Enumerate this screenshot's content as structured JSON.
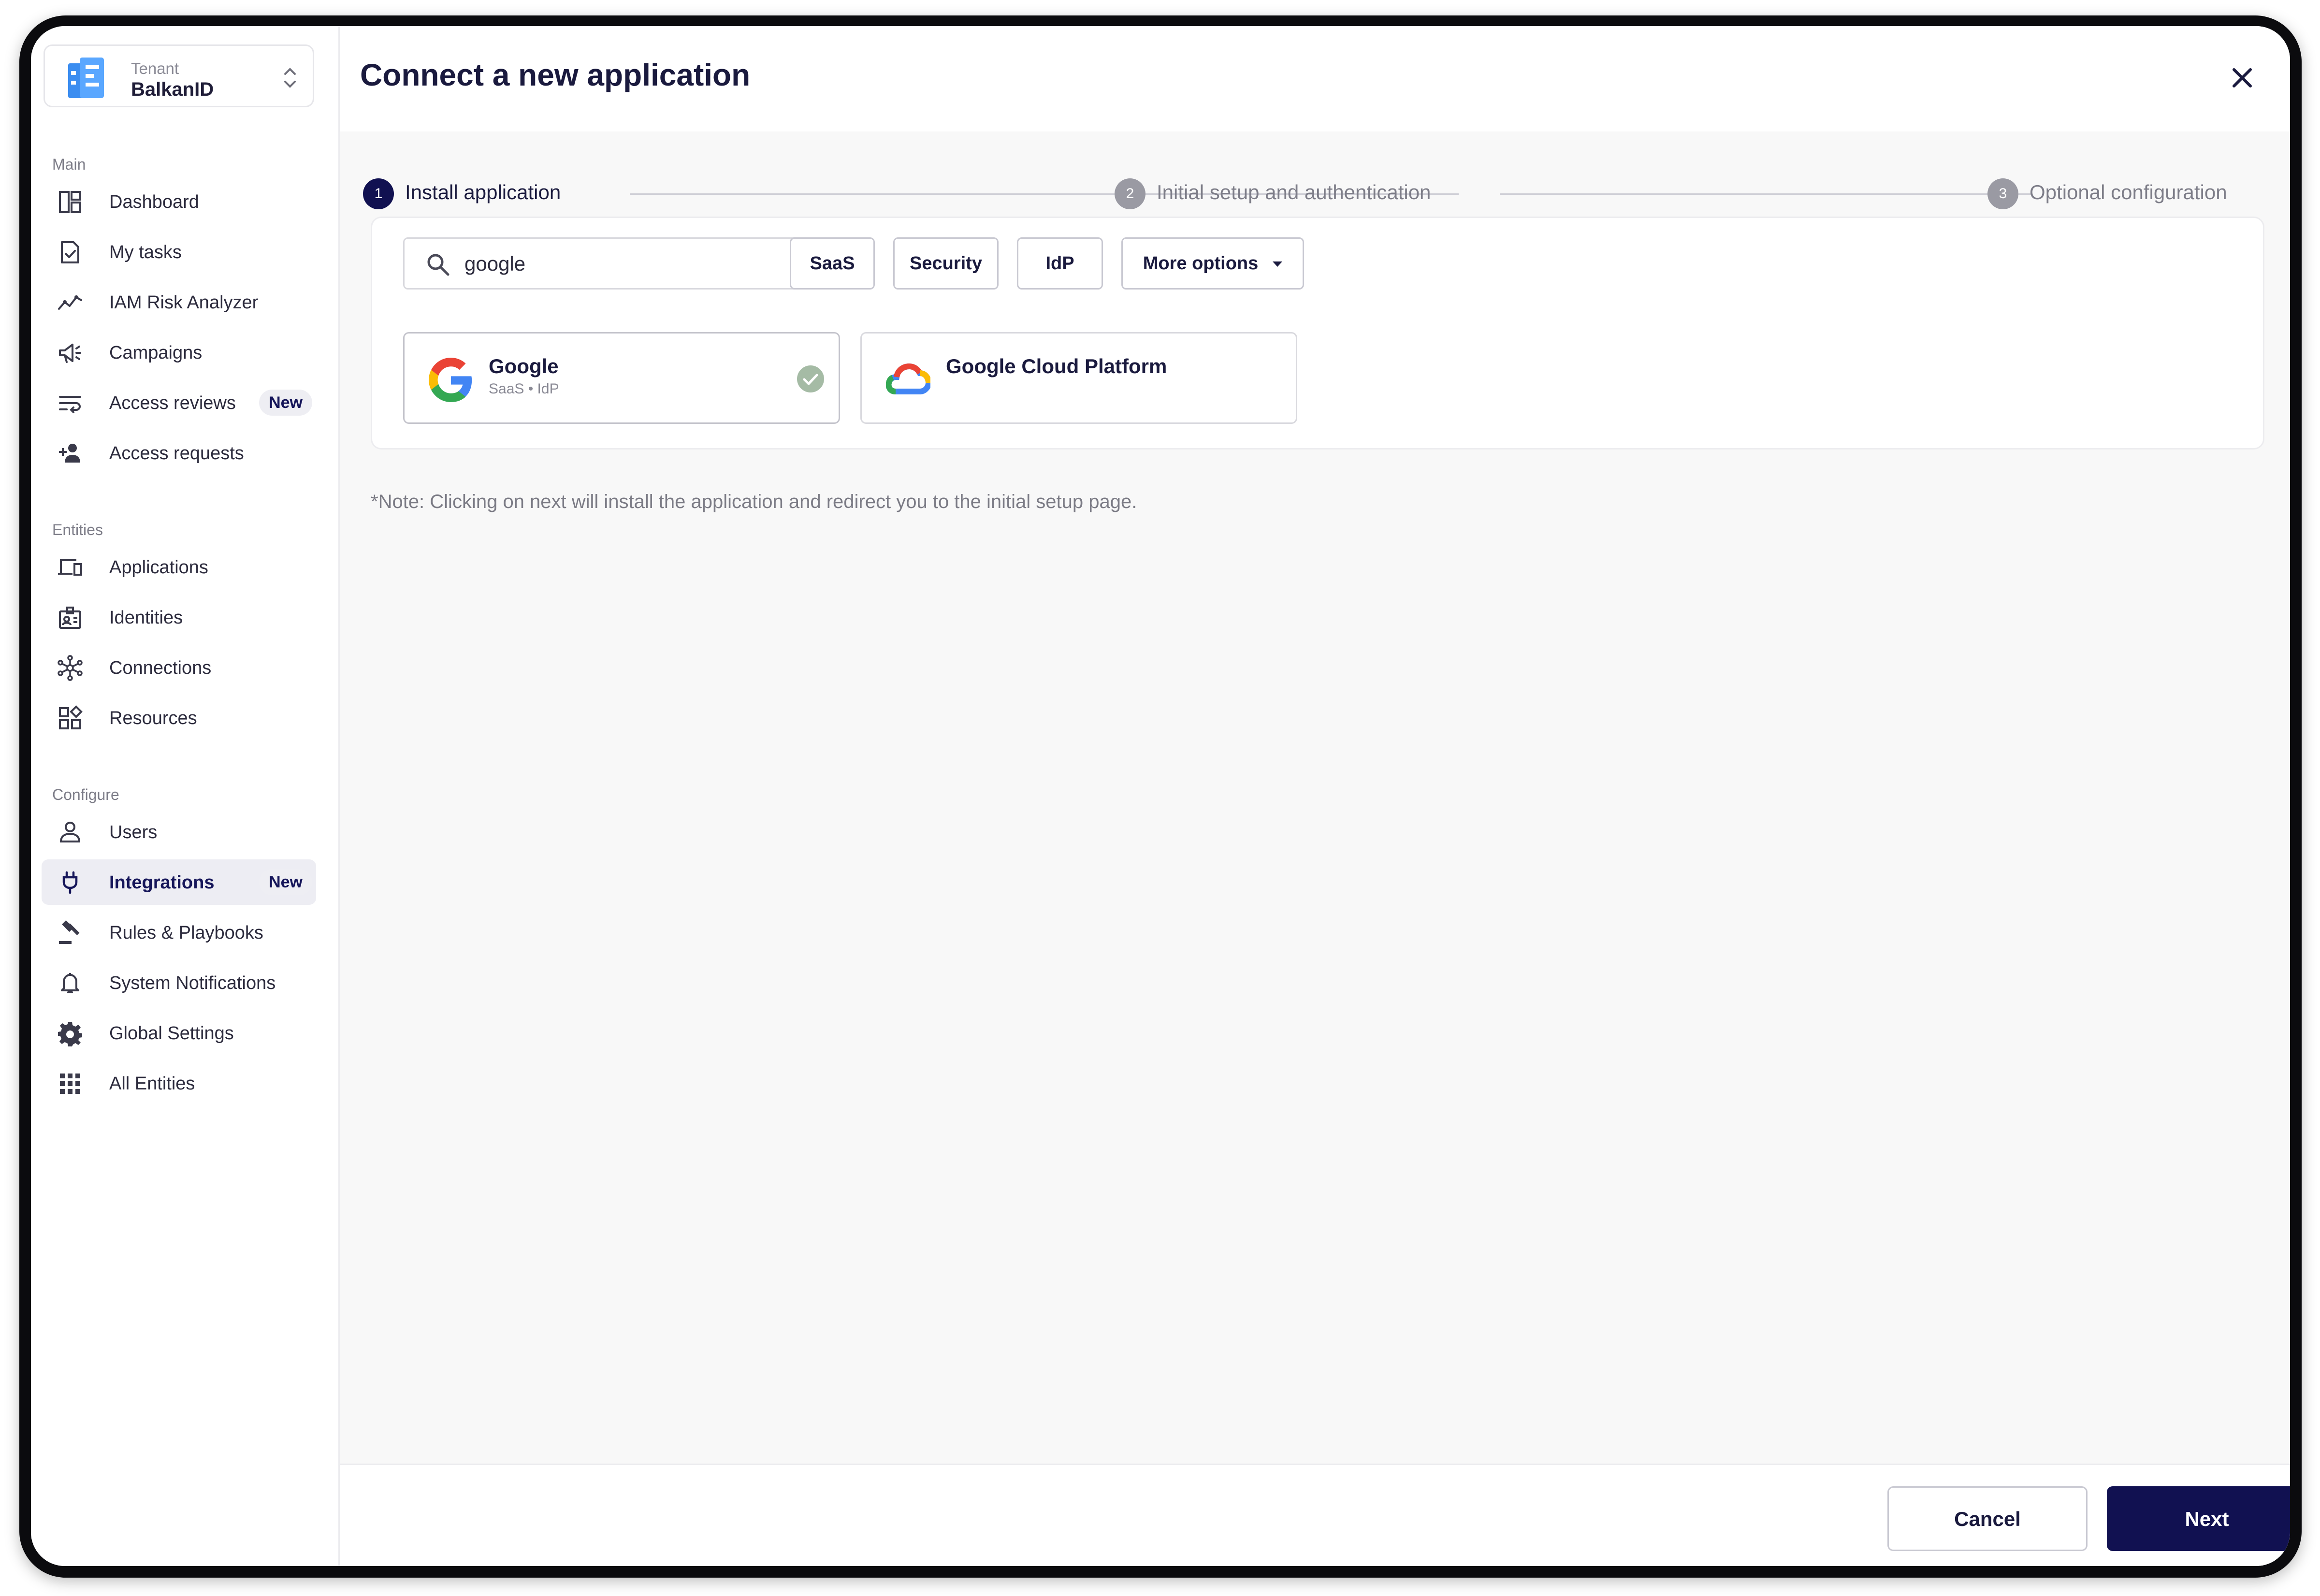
{
  "tenant": {
    "caption": "Tenant",
    "name": "BalkanID"
  },
  "sidebar": {
    "sections": [
      {
        "title": "Main",
        "items": [
          {
            "label": "Dashboard",
            "icon": "dashboard-icon"
          },
          {
            "label": "My tasks",
            "icon": "tasks-icon"
          },
          {
            "label": "IAM Risk Analyzer",
            "icon": "risk-analyzer-icon"
          },
          {
            "label": "Campaigns",
            "icon": "megaphone-icon"
          },
          {
            "label": "Access reviews",
            "icon": "access-reviews-icon",
            "badge": "New"
          },
          {
            "label": "Access requests",
            "icon": "add-person-icon"
          }
        ]
      },
      {
        "title": "Entities",
        "items": [
          {
            "label": "Applications",
            "icon": "devices-icon"
          },
          {
            "label": "Identities",
            "icon": "id-badge-icon"
          },
          {
            "label": "Connections",
            "icon": "network-icon"
          },
          {
            "label": "Resources",
            "icon": "resources-icon"
          }
        ]
      },
      {
        "title": "Configure",
        "items": [
          {
            "label": "Users",
            "icon": "user-icon"
          },
          {
            "label": "Integrations",
            "icon": "plug-icon",
            "badge": "New",
            "active": true
          },
          {
            "label": "Rules & Playbooks",
            "icon": "gavel-icon"
          },
          {
            "label": "System Notifications",
            "icon": "bell-icon"
          },
          {
            "label": "Global Settings",
            "icon": "gear-icon"
          },
          {
            "label": "All Entities",
            "icon": "grid-icon"
          }
        ]
      }
    ]
  },
  "main": {
    "title": "Connect a new application",
    "steps": [
      {
        "number": "1",
        "label": "Install application",
        "active": true
      },
      {
        "number": "2",
        "label": "Initial setup and authentication",
        "active": false
      },
      {
        "number": "3",
        "label": "Optional configuration",
        "active": false
      }
    ],
    "search": {
      "value": "google",
      "placeholder": "Search"
    },
    "filters": {
      "saas": "SaaS",
      "security": "Security",
      "idp": "IdP",
      "more": "More options"
    },
    "apps": [
      {
        "name": "Google",
        "tags": "SaaS • IdP",
        "installed": true
      },
      {
        "name": "Google Cloud Platform",
        "tags": "",
        "installed": false
      }
    ],
    "note": "*Note: Clicking on next will install the application and redirect you to the initial setup page."
  },
  "footer": {
    "cancel": "Cancel",
    "next": "Next"
  },
  "colors": {
    "primary": "#111151",
    "active_nav_bg": "#ededf3",
    "check": "#a5bba5"
  }
}
